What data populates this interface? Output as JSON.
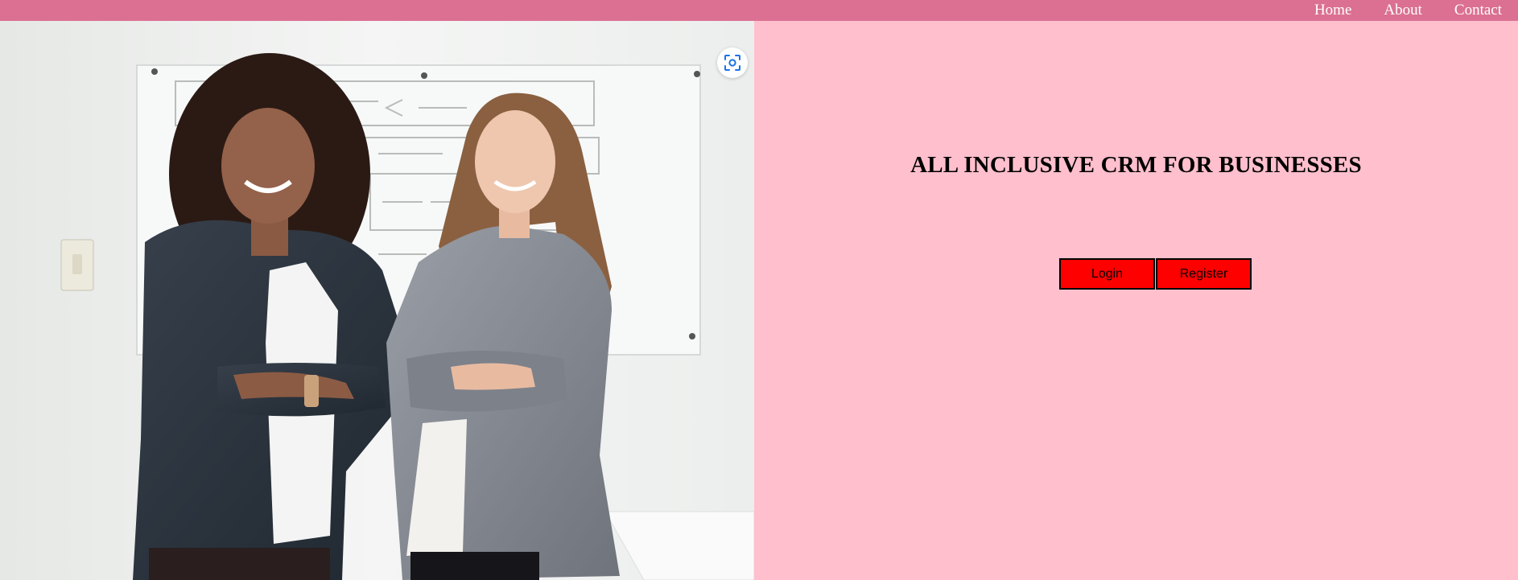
{
  "nav": {
    "items": [
      {
        "label": "Home"
      },
      {
        "label": "About"
      },
      {
        "label": "Contact"
      }
    ]
  },
  "hero": {
    "headline": "ALL INCLUSIVE CRM FOR BUSINESSES",
    "login_label": "Login",
    "register_label": "Register",
    "image_icon": "visual-search-icon"
  },
  "colors": {
    "navbar": "#db7093",
    "background": "#ffbfcd",
    "button": "#ff0000"
  }
}
